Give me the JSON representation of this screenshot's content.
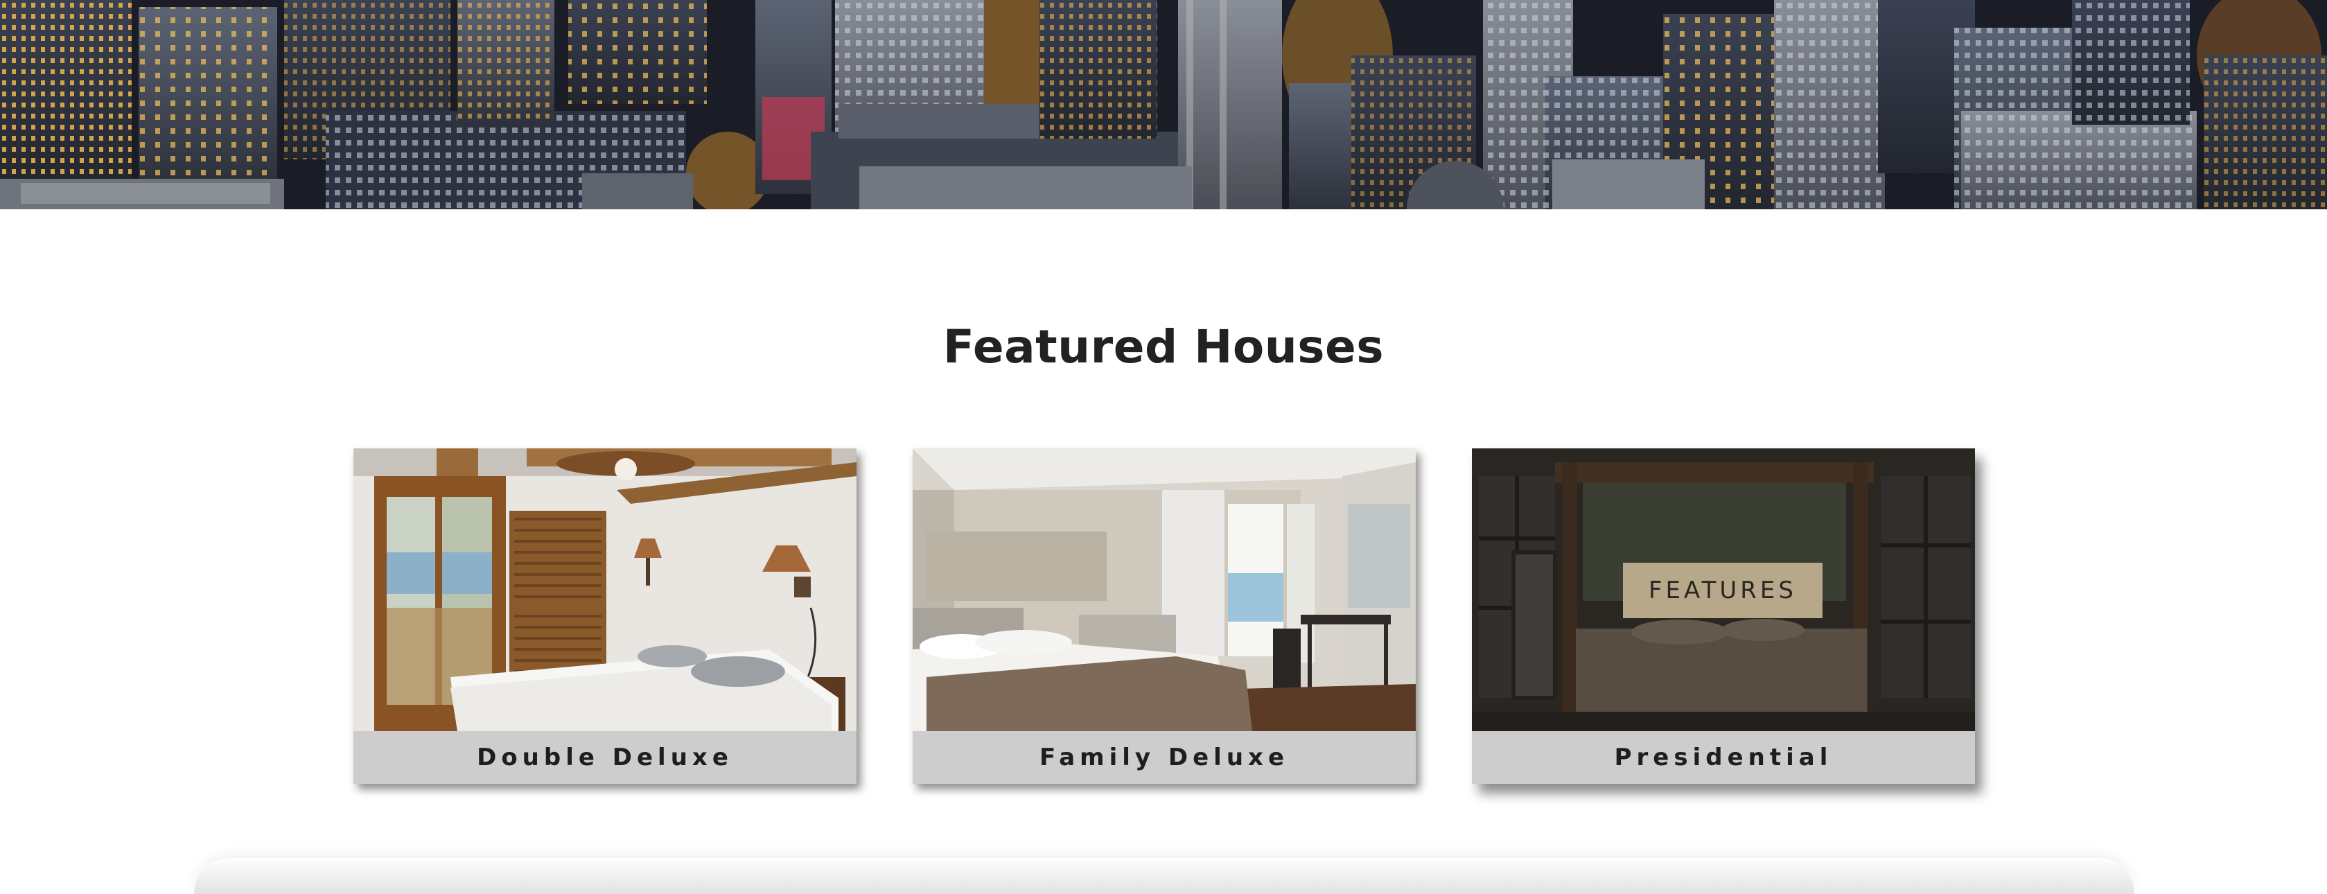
{
  "section": {
    "title": "Featured Houses"
  },
  "cards": [
    {
      "name": "Double Deluxe"
    },
    {
      "name": "Family Deluxe"
    },
    {
      "name": "Presidential",
      "hover_button": "FEATURES"
    }
  ],
  "colors": {
    "caption_bg": "#cdcdcd",
    "features_button": "#b8a88a",
    "title_text": "#222222"
  }
}
